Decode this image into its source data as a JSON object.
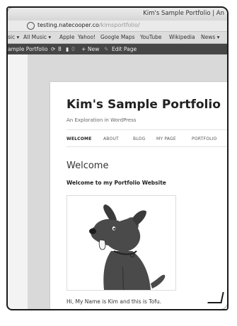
{
  "window": {
    "title": "Kim's Sample Portfolio | An"
  },
  "address": {
    "host": "testing.natecooper.co",
    "path": "/kimsportfolio/"
  },
  "bookmarks": [
    "sic ▾",
    "All Music ▾",
    "Apple",
    "Yahoo!",
    "Google Maps",
    "YouTube",
    "Wikipedia",
    "News ▾"
  ],
  "adminbar": {
    "site": "ample Portfolio",
    "updates": "8",
    "comments": "0",
    "new": "New",
    "edit": "Edit Page"
  },
  "site": {
    "title": "Kim's Sample Portfolio",
    "description": "An Exploration in WordPress"
  },
  "nav": [
    "WELCOME",
    "ABOUT",
    "BLOG",
    "MY PAGE",
    "PORTFOLIO"
  ],
  "content": {
    "heading": "Welcome",
    "intro": "Welcome to my Portfolio Website",
    "caption": "Hi, My Name is Kim and this is Tofu."
  },
  "colors": {
    "adminbar": "#464646",
    "page_bg": "#d9d9d9",
    "dog": "#4a4a4a"
  }
}
